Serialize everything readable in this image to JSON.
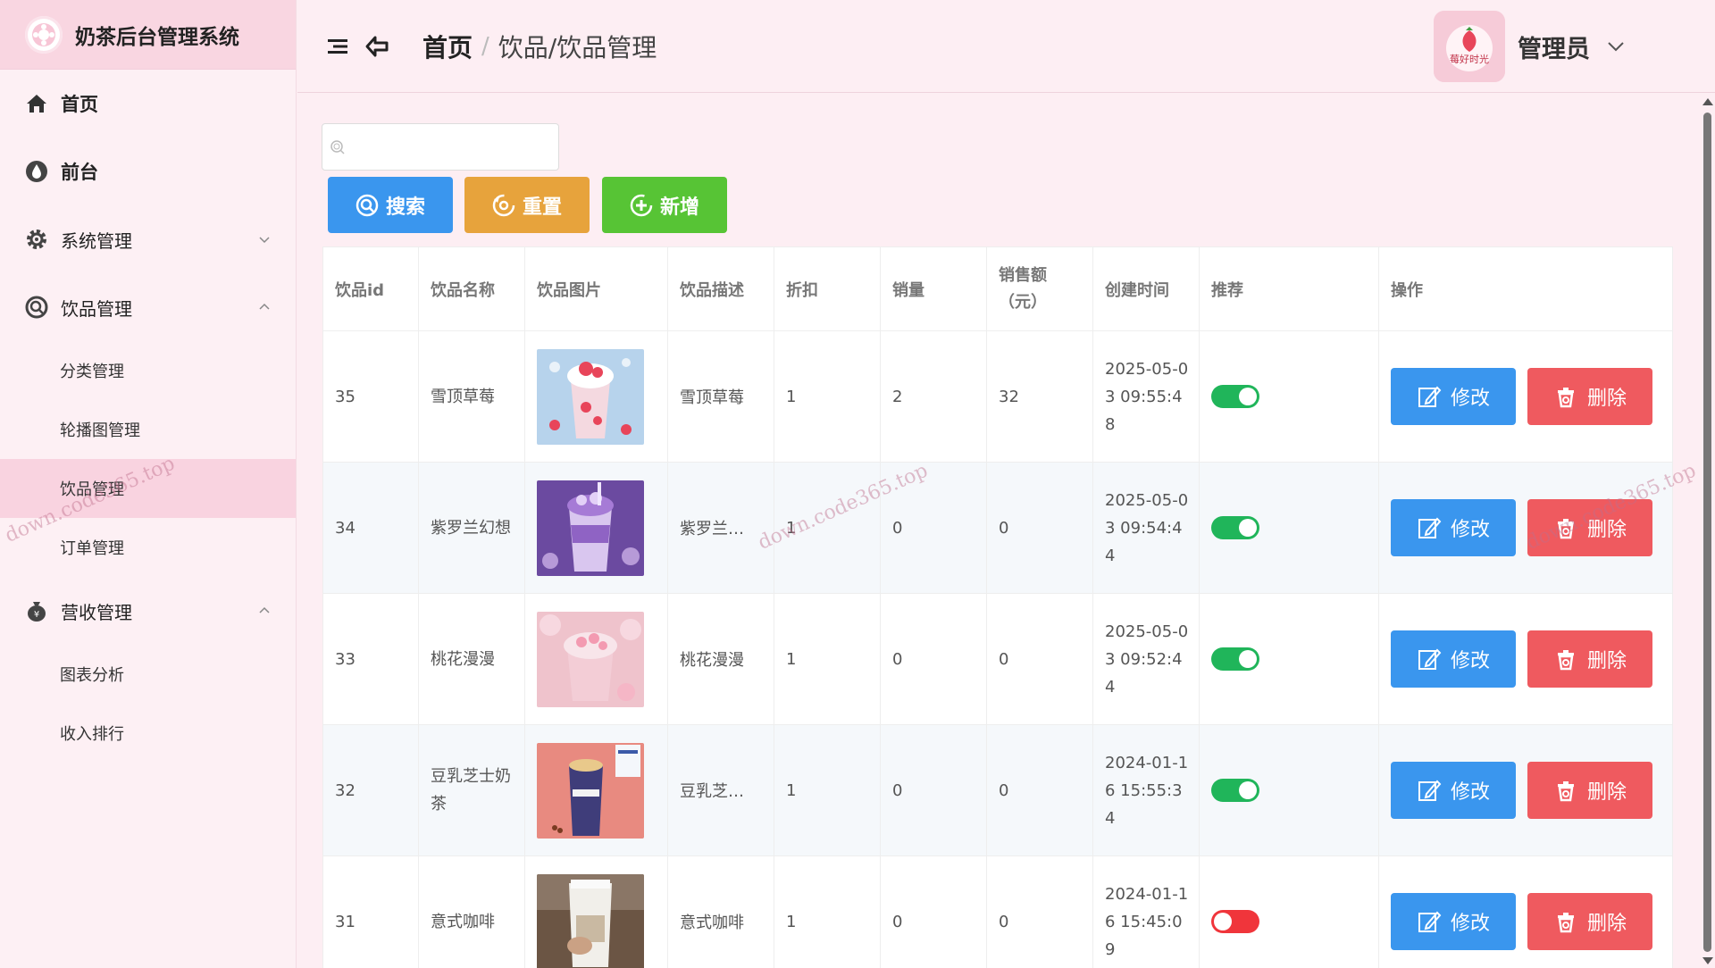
{
  "app": {
    "title": "奶茶后台管理系统"
  },
  "sidebar": {
    "items": [
      {
        "label": "首页",
        "icon": "home-icon"
      },
      {
        "label": "前台",
        "icon": "drop-icon"
      },
      {
        "label": "系统管理",
        "icon": "gear-icon"
      },
      {
        "label": "饮品管理",
        "icon": "search-circle-icon"
      },
      {
        "label": "营收管理",
        "icon": "money-bag-icon"
      }
    ],
    "drink_sub": [
      "分类管理",
      "轮播图管理",
      "饮品管理",
      "订单管理"
    ],
    "revenue_sub": [
      "图表分析",
      "收入排行"
    ]
  },
  "header": {
    "home": "首页",
    "separator": "/",
    "current": "饮品/饮品管理",
    "user": "管理员",
    "avatar_text": "莓好时光"
  },
  "toolbar": {
    "search_placeholder": "",
    "search_label": "搜索",
    "reset_label": "重置",
    "add_label": "新增"
  },
  "table": {
    "headers": [
      "饮品id",
      "饮品名称",
      "饮品图片",
      "饮品描述",
      "折扣",
      "销量",
      "销售额（元）",
      "创建时间",
      "推荐",
      "操作"
    ],
    "rows": [
      {
        "id": "35",
        "name": "雪顶草莓",
        "desc": "雪顶草莓",
        "discount": "1",
        "sales": "2",
        "amount": "32",
        "created": "2025-05-03 09:55:48",
        "recommend": true
      },
      {
        "id": "34",
        "name": "紫罗兰幻想",
        "desc": "紫罗兰…",
        "discount": "1",
        "sales": "0",
        "amount": "0",
        "created": "2025-05-03 09:54:44",
        "recommend": true
      },
      {
        "id": "33",
        "name": "桃花漫漫",
        "desc": "桃花漫漫",
        "discount": "1",
        "sales": "0",
        "amount": "0",
        "created": "2025-05-03 09:52:44",
        "recommend": true
      },
      {
        "id": "32",
        "name": "豆乳芝士奶茶",
        "desc": "豆乳芝…",
        "discount": "1",
        "sales": "0",
        "amount": "0",
        "created": "2024-01-16 15:55:34",
        "recommend": true
      },
      {
        "id": "31",
        "name": "意式咖啡",
        "desc": "意式咖啡",
        "discount": "1",
        "sales": "0",
        "amount": "0",
        "created": "2024-01-16 15:45:09",
        "recommend": false
      }
    ],
    "edit_label": "修改",
    "delete_label": "删除"
  },
  "watermark": "down.code365.top",
  "colors": {
    "primary": "#3a96ee",
    "warning": "#e7a33c",
    "success": "#57c435",
    "danger": "#ef5a5f",
    "toggle_on": "#20b55a",
    "toggle_off": "#f0353b"
  }
}
